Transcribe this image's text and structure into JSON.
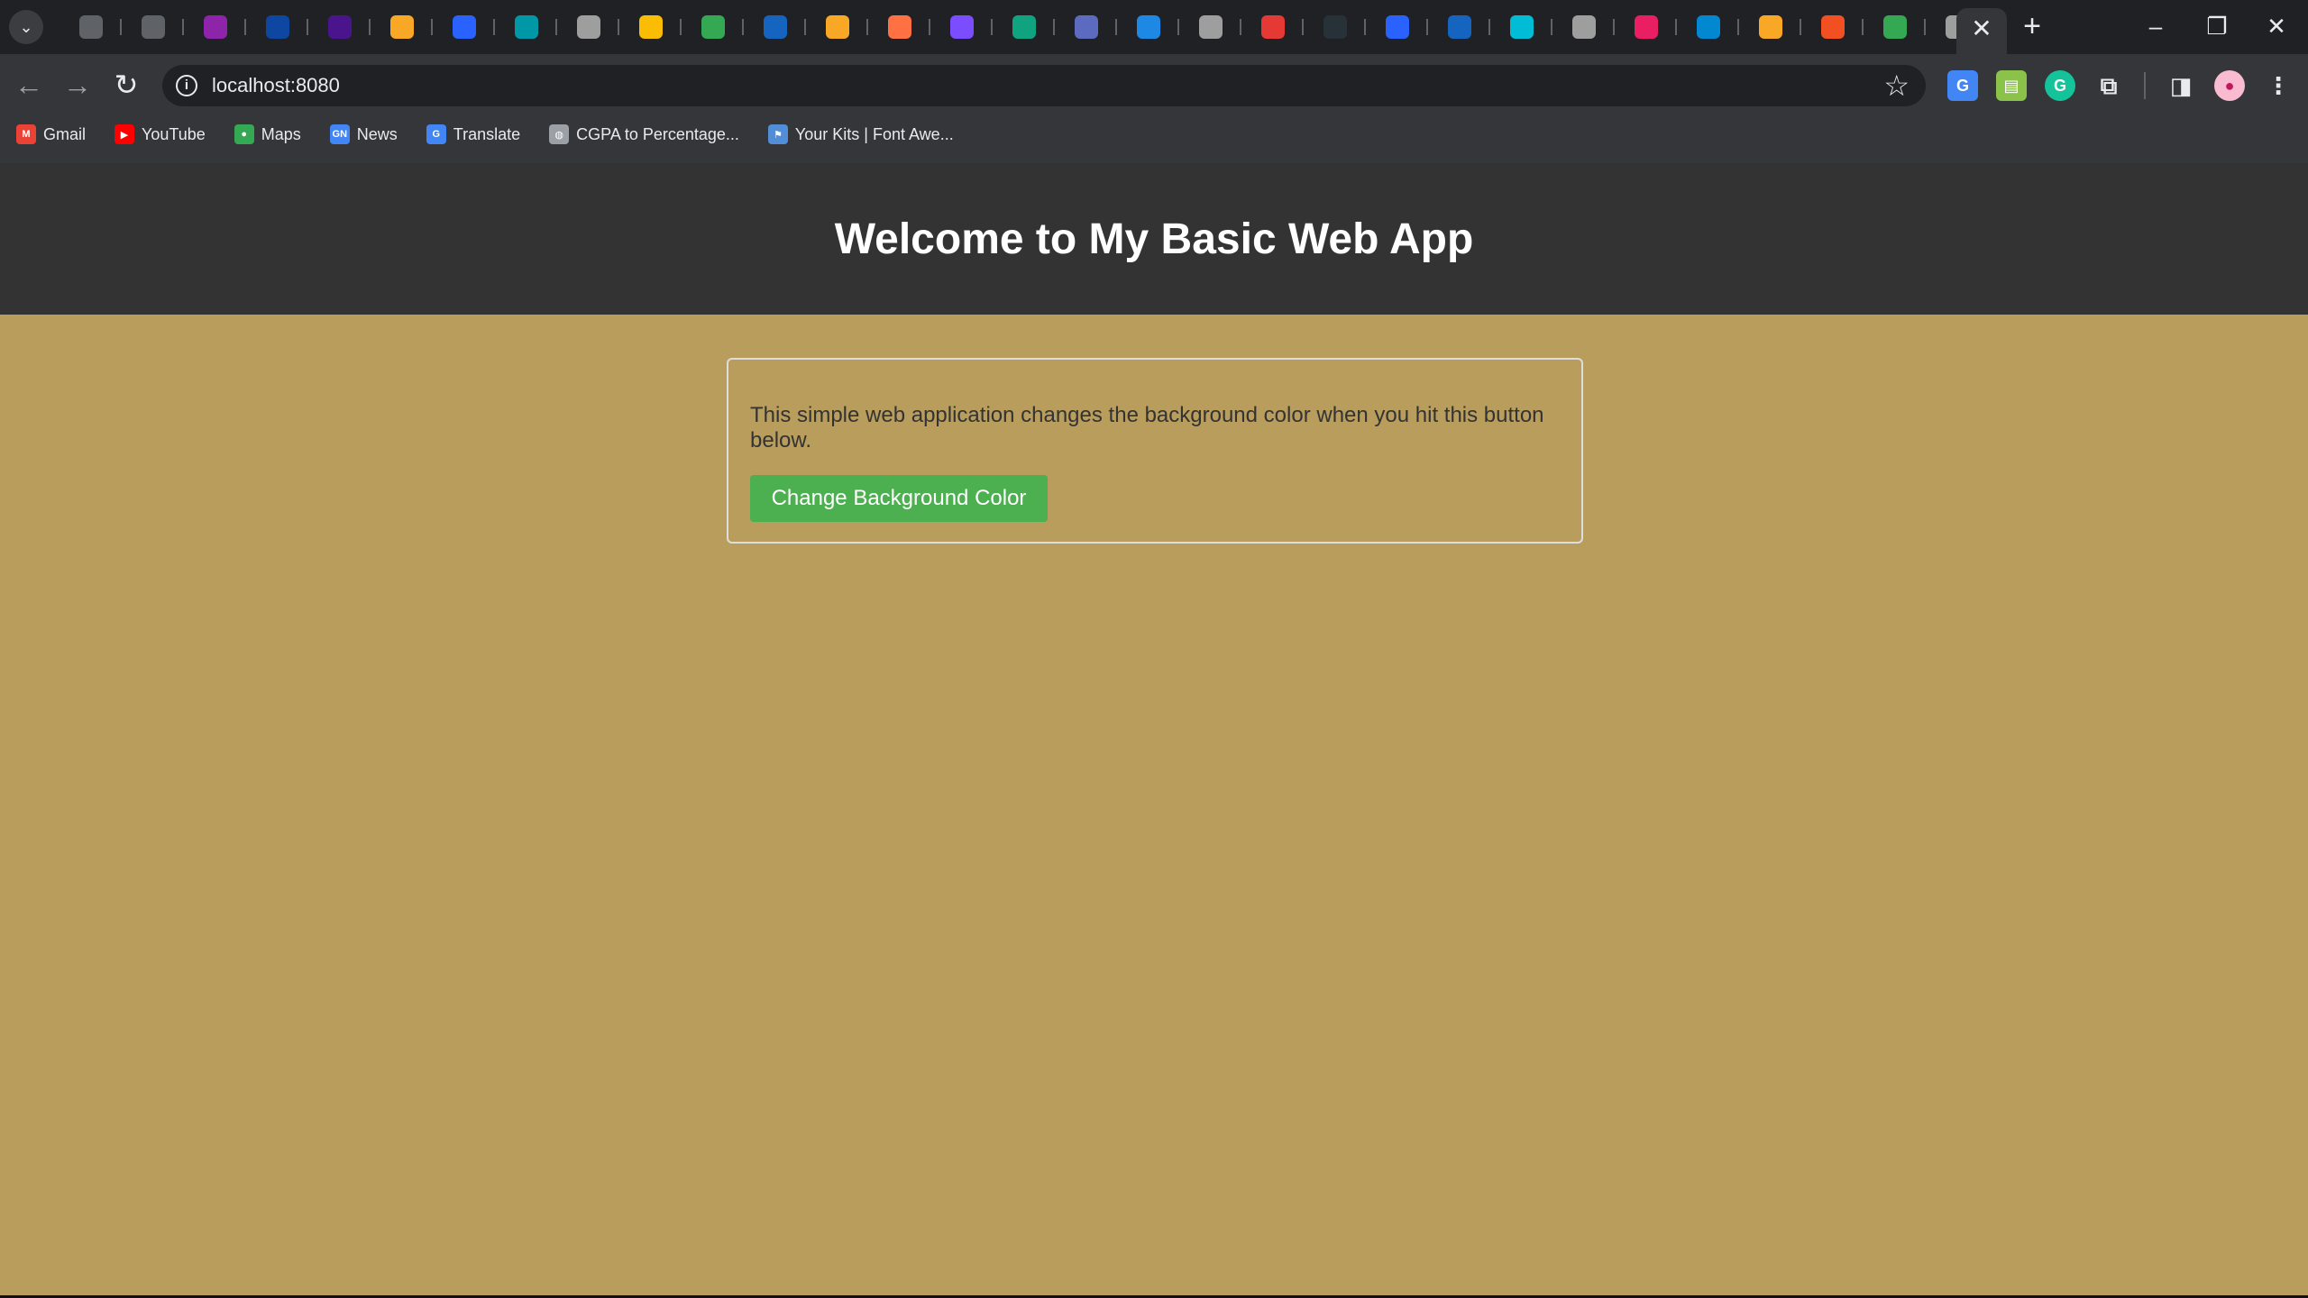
{
  "browser": {
    "tab_close_glyph": "✕",
    "new_tab_glyph": "+",
    "url": "localhost:8080",
    "bookmarks": [
      {
        "label": "Gmail",
        "icon": "gmail-icon",
        "color": "#ea4335",
        "glyph": "M"
      },
      {
        "label": "YouTube",
        "icon": "youtube-icon",
        "color": "#ff0000",
        "glyph": "▶"
      },
      {
        "label": "Maps",
        "icon": "maps-icon",
        "color": "#34a853",
        "glyph": "●"
      },
      {
        "label": "News",
        "icon": "news-icon",
        "color": "#4285f4",
        "glyph": "GN"
      },
      {
        "label": "Translate",
        "icon": "translate-icon",
        "color": "#4285f4",
        "glyph": "G"
      },
      {
        "label": "CGPA to Percentage...",
        "icon": "globe-icon",
        "color": "#9aa0a6",
        "glyph": "◍"
      },
      {
        "label": "Your Kits | Font Awe...",
        "icon": "flag-icon",
        "color": "#528dd7",
        "glyph": "⚑"
      }
    ],
    "pinned_tab_colors": [
      "#5f6368",
      "#5f6368",
      "#8e24aa",
      "#0d47a1",
      "#4a148c",
      "#f9a825",
      "#2962ff",
      "#0097a7",
      "#9e9e9e",
      "#fbbc04",
      "#34a853",
      "#1565c0",
      "#f9a825",
      "#ff7043",
      "#7c4dff",
      "#10a37f",
      "#5c6bc0",
      "#1e88e5",
      "#9e9e9e",
      "#e53935",
      "#263238",
      "#2962ff",
      "#1565c0",
      "#00bcd4",
      "#9e9e9e",
      "#e91e63",
      "#0288d1",
      "#f9a825",
      "#f25022",
      "#34a853",
      "#9e9e9e"
    ]
  },
  "page": {
    "title": "Welcome to My Basic Web App",
    "description": "This simple web application changes the background color when you hit this button below.",
    "button_label": "Change Background Color",
    "background_color": "#b99d5d",
    "button_color": "#4caf50"
  }
}
